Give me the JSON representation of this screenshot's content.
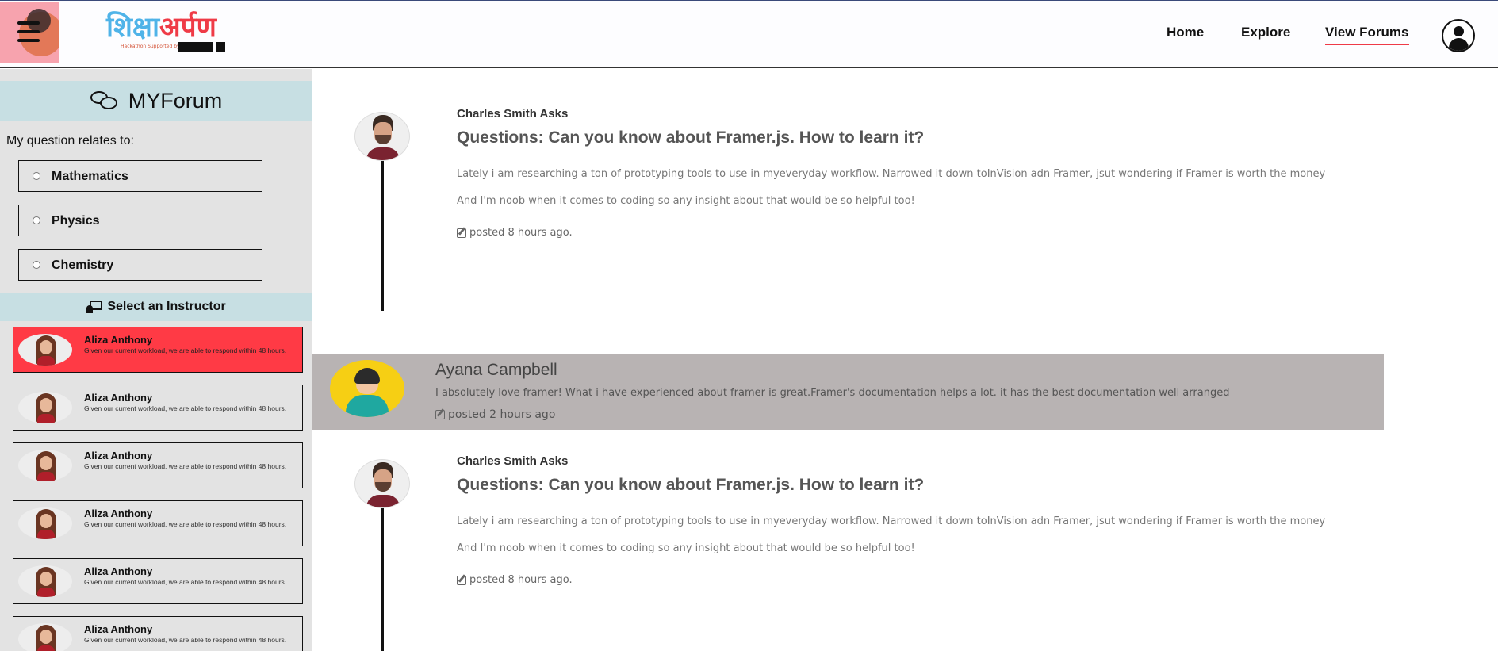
{
  "header": {
    "logo": {
      "part1": "शिक्षा",
      "part2": "अर्पण",
      "sub": "Hackathon Supported by"
    },
    "nav": {
      "home": "Home",
      "explore": "Explore",
      "forums": "View Forums"
    }
  },
  "sidebar": {
    "forum_title": "MYForum",
    "relates_label": "My question relates to:",
    "subjects": [
      {
        "label": "Mathematics"
      },
      {
        "label": "Physics"
      },
      {
        "label": "Chemistry"
      }
    ],
    "instructor_title": "Select an Instructor",
    "instructors": [
      {
        "name": "Aliza Anthony",
        "desc": "Given our current workload, we are able to respond within 48 hours.",
        "active": true
      },
      {
        "name": "Aliza Anthony",
        "desc": "Given our current workload, we are able to respond within 48 hours."
      },
      {
        "name": "Aliza Anthony",
        "desc": "Given our current workload, we are able to respond within 48 hours."
      },
      {
        "name": "Aliza Anthony",
        "desc": "Given our current workload, we are able to respond within 48 hours."
      },
      {
        "name": "Aliza Anthony",
        "desc": "Given our current workload, we are able to respond within 48 hours."
      },
      {
        "name": "Aliza Anthony",
        "desc": "Given our current workload, we are able to respond within 48 hours."
      }
    ]
  },
  "questions": [
    {
      "asker": "Charles Smith Asks",
      "title": "Questions: Can you know about Framer.js. How to learn it?",
      "line1": "Lately i am researching a ton of prototyping tools to use in myeveryday workflow. Narrowed it down toInVision adn Framer, jsut wondering if Framer is worth the money",
      "line2": "And I'm noob when it comes to coding so any insight about that would be so helpful too!",
      "posted": "posted 8 hours ago."
    },
    {
      "asker": "Charles Smith Asks",
      "title": "Questions: Can you know about Framer.js. How to learn it?",
      "line1": "Lately i am researching a ton of prototyping tools to use in myeveryday workflow. Narrowed it down toInVision adn Framer, jsut wondering if Framer is worth the money",
      "line2": "And I'm noob when it comes to coding so any insight about that would be so helpful too!",
      "posted": "posted 8 hours ago."
    }
  ],
  "answer": {
    "name": "Ayana Campbell",
    "text": "I absolutely love framer! What i have experienced about framer is great.Framer's documentation helps a lot. it has the best documentation well arranged",
    "posted": "posted 2 hours ago"
  }
}
